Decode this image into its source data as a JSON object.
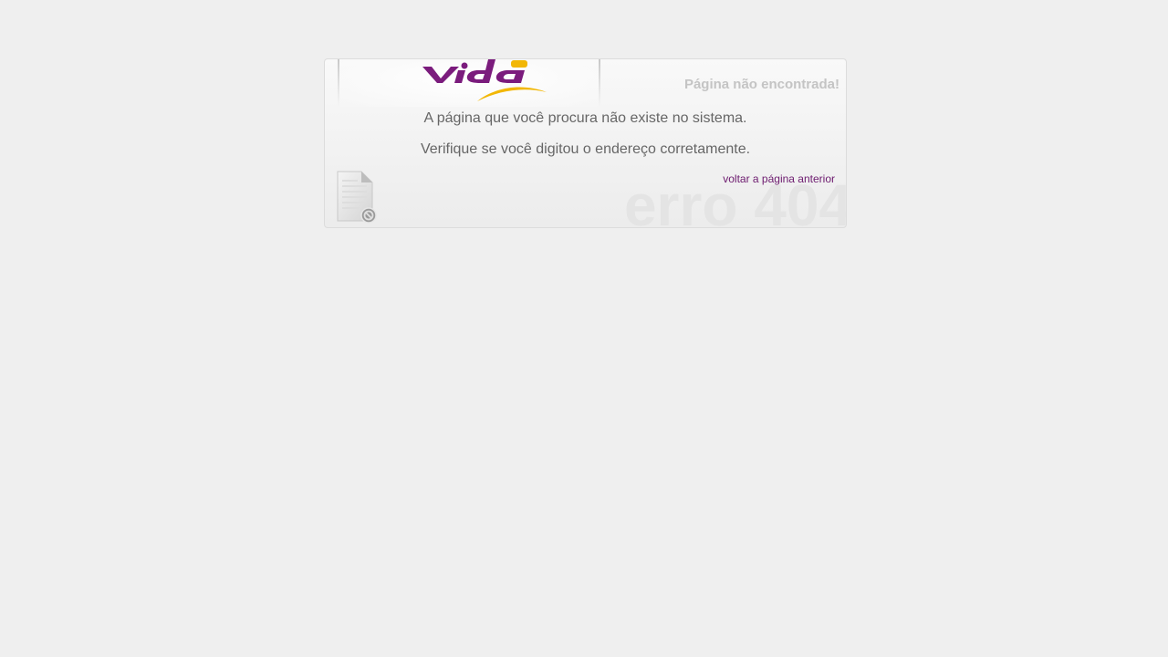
{
  "brand": {
    "logo_text": "Vidá",
    "colors": {
      "purple": "#7b1c7d",
      "yellow": "#f2b705"
    }
  },
  "error": {
    "title": "Página não encontrada!",
    "message_1": "A página que você procura não existe no sistema.",
    "message_2": "Verifique se você digitou o endereço corretamente.",
    "back_link": "voltar a página anterior",
    "code_watermark": "erro 404",
    "icon": "broken-document-icon"
  }
}
